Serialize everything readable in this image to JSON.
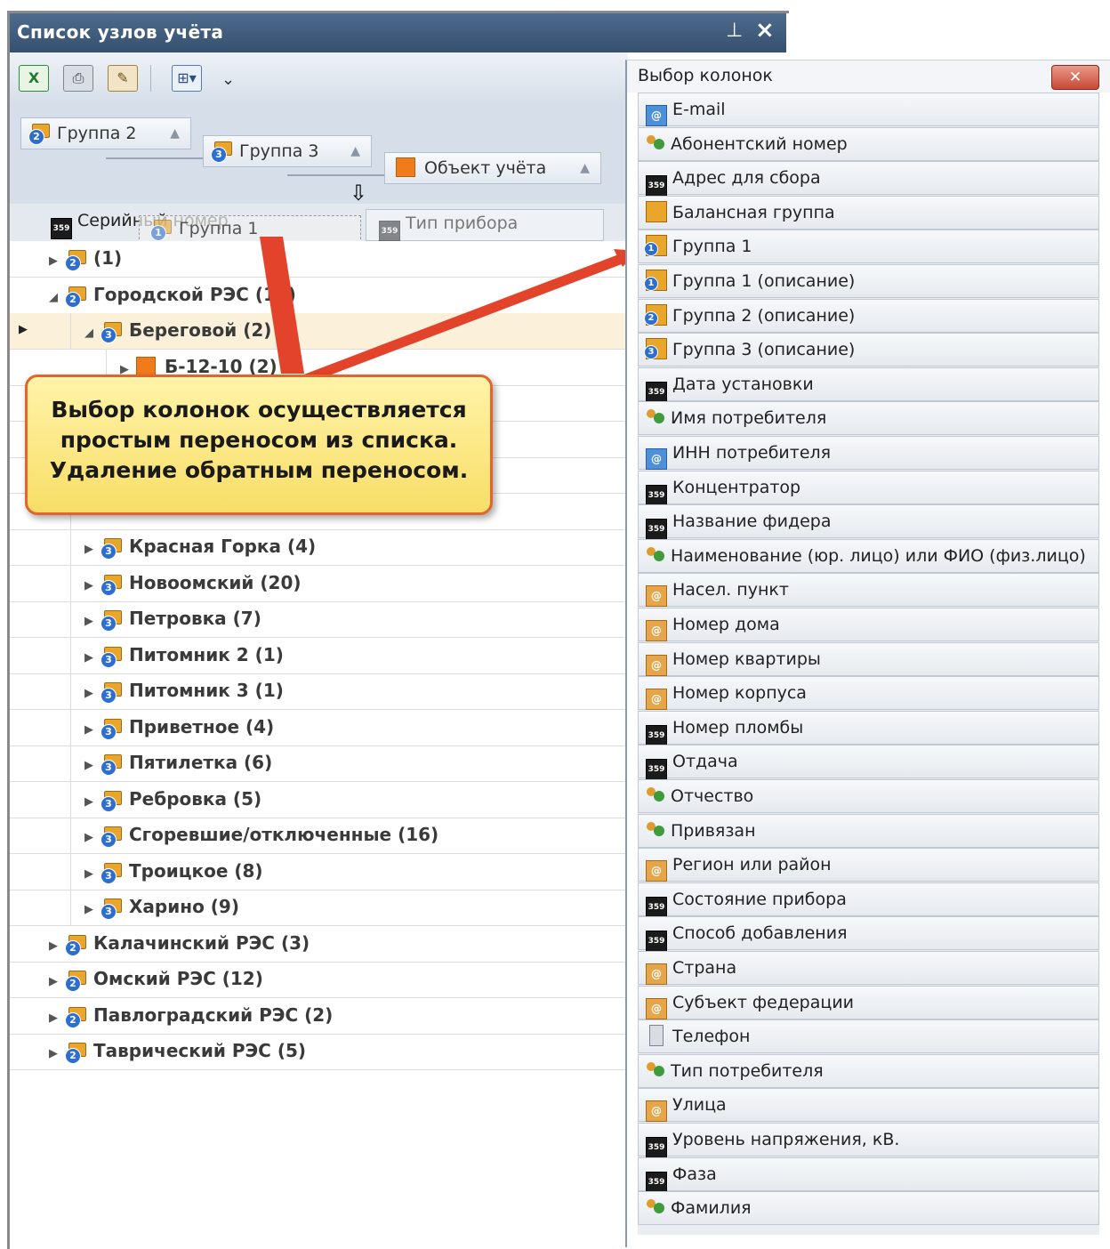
{
  "window": {
    "title": "Список узлов учёта",
    "pin_icon": "pin-icon",
    "close_icon": "close-icon"
  },
  "toolbar": {
    "buttons": [
      {
        "name": "export-excel-button",
        "icon": "excel-icon",
        "glyph": "X"
      },
      {
        "name": "print-button",
        "icon": "printer-icon",
        "glyph": "⎙"
      },
      {
        "name": "settings-button",
        "icon": "settings-icon",
        "glyph": "✎"
      },
      {
        "name": "expand-button",
        "icon": "expand-collapse-icon",
        "glyph": "⊞▾"
      }
    ],
    "more_glyph": "⌄"
  },
  "group_area": {
    "chips": [
      {
        "label": "Группа 2",
        "level": "2"
      },
      {
        "label": "Группа 3",
        "level": "3"
      },
      {
        "label": "Объект учёта"
      }
    ]
  },
  "columns": {
    "serial": "Серийный номер",
    "type": "Тип прибора",
    "dragged": "Группа 1"
  },
  "tree": {
    "rows": [
      {
        "label": "(1)",
        "level": 0,
        "badge": "2",
        "expanded": false
      },
      {
        "label": "Городской РЭС (15)",
        "level": 0,
        "badge": "2",
        "expanded": true
      },
      {
        "label": "Береговой (2)",
        "level": 1,
        "badge": "3",
        "expanded": true,
        "selected": true
      },
      {
        "label": "Б-12-10 (2)",
        "level": 2,
        "badge": "obj",
        "expanded": false
      },
      {
        "label": "",
        "level": 1,
        "badge": "",
        "expanded": false
      },
      {
        "label": "",
        "level": 1,
        "badge": "",
        "expanded": false
      },
      {
        "label": "",
        "level": 1,
        "badge": "",
        "expanded": false
      },
      {
        "label": "",
        "level": 1,
        "badge": "",
        "expanded": false
      },
      {
        "label": "Красная Горка (4)",
        "level": 1,
        "badge": "3",
        "expanded": false
      },
      {
        "label": "Новоомский (20)",
        "level": 1,
        "badge": "3",
        "expanded": false
      },
      {
        "label": "Петровка (7)",
        "level": 1,
        "badge": "3",
        "expanded": false
      },
      {
        "label": "Питомник 2 (1)",
        "level": 1,
        "badge": "3",
        "expanded": false
      },
      {
        "label": "Питомник 3 (1)",
        "level": 1,
        "badge": "3",
        "expanded": false
      },
      {
        "label": "Приветное (4)",
        "level": 1,
        "badge": "3",
        "expanded": false
      },
      {
        "label": "Пятилетка (6)",
        "level": 1,
        "badge": "3",
        "expanded": false
      },
      {
        "label": "Ребровка (5)",
        "level": 1,
        "badge": "3",
        "expanded": false
      },
      {
        "label": "Сгоревшие/отключенные (16)",
        "level": 1,
        "badge": "3",
        "expanded": false
      },
      {
        "label": "Троицкое (8)",
        "level": 1,
        "badge": "3",
        "expanded": false
      },
      {
        "label": "Харино (9)",
        "level": 1,
        "badge": "3",
        "expanded": false
      },
      {
        "label": "Калачинский РЭС (3)",
        "level": 0,
        "badge": "2",
        "expanded": false
      },
      {
        "label": "Омский РЭС (12)",
        "level": 0,
        "badge": "2",
        "expanded": false
      },
      {
        "label": "Павлоградский РЭС (2)",
        "level": 0,
        "badge": "2",
        "expanded": false
      },
      {
        "label": "Таврический РЭС (5)",
        "level": 0,
        "badge": "2",
        "expanded": false
      }
    ]
  },
  "callout": {
    "text": "Выбор колонок осуществляется\nпростым переносом из списка.\nУдаление обратным переносом."
  },
  "chooser": {
    "title": "Выбор колонок",
    "close_glyph": "✕",
    "items": [
      {
        "label": "E-mail",
        "icon": "email"
      },
      {
        "label": "Абонентский номер",
        "icon": "person"
      },
      {
        "label": "Адрес для сбора",
        "icon": "num"
      },
      {
        "label": "Балансная группа",
        "icon": "balance"
      },
      {
        "label": "Группа 1",
        "icon": "grp",
        "level": "1"
      },
      {
        "label": "Группа 1 (описание)",
        "icon": "grp",
        "level": "1"
      },
      {
        "label": "Группа 2 (описание)",
        "icon": "grp",
        "level": "2"
      },
      {
        "label": "Группа 3 (описание)",
        "icon": "grp",
        "level": "3"
      },
      {
        "label": "Дата установки",
        "icon": "num"
      },
      {
        "label": "Имя потребителя",
        "icon": "person"
      },
      {
        "label": "ИНН потребителя",
        "icon": "email"
      },
      {
        "label": "Концентратор",
        "icon": "num"
      },
      {
        "label": "Название фидера",
        "icon": "num"
      },
      {
        "label": "Наименование (юр. лицо) или ФИО (физ.лицо)",
        "icon": "person"
      },
      {
        "label": "Насел. пункт",
        "icon": "addr"
      },
      {
        "label": "Номер дома",
        "icon": "addr"
      },
      {
        "label": "Номер квартиры",
        "icon": "addr"
      },
      {
        "label": "Номер корпуса",
        "icon": "addr"
      },
      {
        "label": "Номер пломбы",
        "icon": "num"
      },
      {
        "label": "Отдача",
        "icon": "num"
      },
      {
        "label": "Отчество",
        "icon": "person"
      },
      {
        "label": "Привязан",
        "icon": "person"
      },
      {
        "label": "Регион или район",
        "icon": "addr"
      },
      {
        "label": "Состояние прибора",
        "icon": "num"
      },
      {
        "label": "Способ добавления",
        "icon": "num"
      },
      {
        "label": "Страна",
        "icon": "addr"
      },
      {
        "label": "Субъект федерации",
        "icon": "addr"
      },
      {
        "label": "Телефон",
        "icon": "phone"
      },
      {
        "label": "Тип потребителя",
        "icon": "person"
      },
      {
        "label": "Улица",
        "icon": "addr"
      },
      {
        "label": "Уровень напряжения, кВ.",
        "icon": "num"
      },
      {
        "label": "Фаза",
        "icon": "num"
      },
      {
        "label": "Фамилия",
        "icon": "person"
      }
    ]
  },
  "colors": {
    "title_bar": "#4d6b8f",
    "selection": "#fbf1db",
    "callout_border": "#e0662d",
    "arrow": "#e4432b"
  }
}
